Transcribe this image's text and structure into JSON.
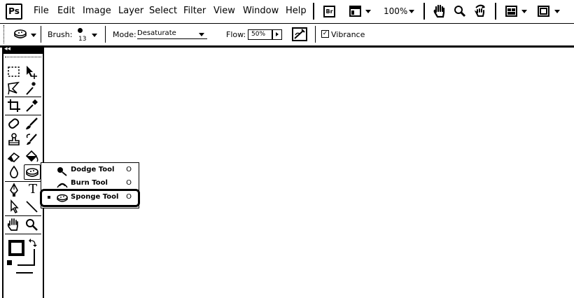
{
  "app": {
    "logo_text": "Ps"
  },
  "menu": [
    {
      "label": "File"
    },
    {
      "label": "Edit"
    },
    {
      "label": "Image"
    },
    {
      "label": "Layer"
    },
    {
      "label": "Select"
    },
    {
      "label": "Filter"
    },
    {
      "label": "View"
    },
    {
      "label": "Window"
    },
    {
      "label": "Help"
    }
  ],
  "menubar_right": {
    "bridge_icon_text": "Br",
    "zoom_level": "100%",
    "icons": [
      "bridge-icon",
      "screen-layout-icon",
      "hand-icon",
      "zoom-icon",
      "rotate-view-icon",
      "arrange-documents-icon",
      "screen-mode-icon"
    ]
  },
  "options_bar": {
    "brush_label": "Brush:",
    "brush_size": "13",
    "mode_label": "Mode:",
    "mode_value": "Desaturate",
    "flow_label": "Flow:",
    "flow_value": "50%",
    "vibrance_label": "Vibrance",
    "vibrance_checked": true,
    "vibrance_check_glyph": "✓"
  },
  "toolbox": {
    "header_glyph": "◂◂",
    "tools": [
      "marquee-icon",
      "move-icon",
      "lasso-icon",
      "magic-wand-icon",
      "crop-icon",
      "eyedropper-icon",
      "healing-brush-icon",
      "brush-icon",
      "clone-stamp-icon",
      "history-brush-icon",
      "eraser-icon",
      "paint-bucket-icon",
      "blur-icon",
      "sponge-icon",
      "pen-icon",
      "type-icon",
      "path-selection-icon",
      "line-icon",
      "hand-icon",
      "zoom-icon",
      "foreground-color-icon",
      "swap-colors-icon",
      "default-colors-icon",
      "quick-mask-icon"
    ],
    "type_glyph": "T"
  },
  "flyout": {
    "items": [
      {
        "label": "Dodge Tool",
        "shortcut": "O",
        "selected": false
      },
      {
        "label": "Burn Tool",
        "shortcut": "O",
        "selected": false
      },
      {
        "label": "Sponge Tool",
        "shortcut": "O",
        "selected": true
      }
    ]
  }
}
